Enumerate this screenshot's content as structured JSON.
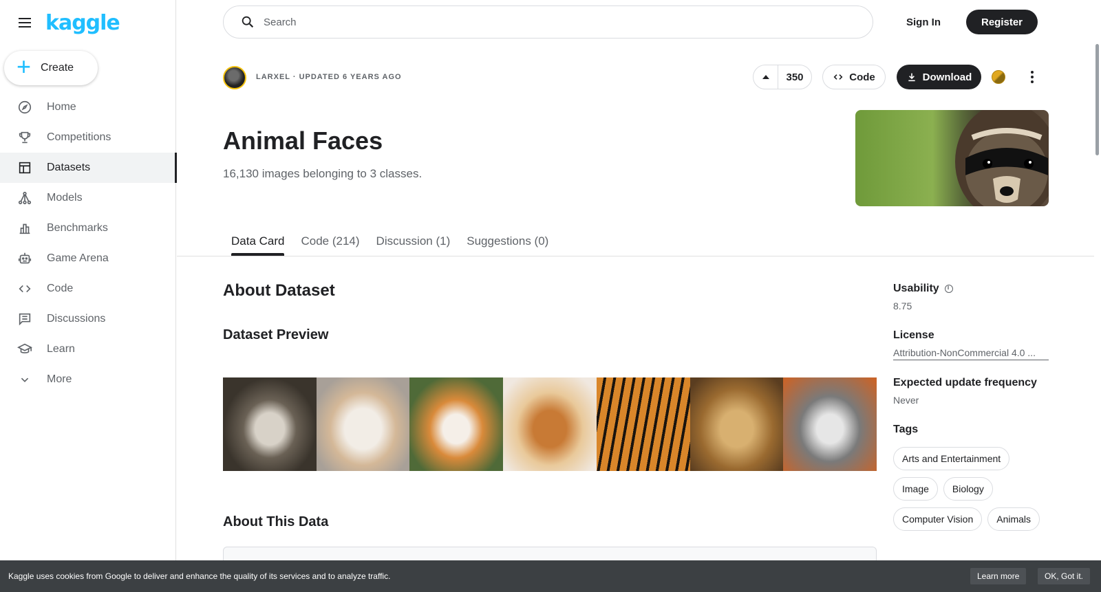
{
  "sidebar": {
    "logo": "kaggle",
    "create_label": "Create",
    "items": [
      {
        "label": "Home",
        "icon": "compass-icon"
      },
      {
        "label": "Competitions",
        "icon": "trophy-icon"
      },
      {
        "label": "Datasets",
        "icon": "table-icon",
        "active": true
      },
      {
        "label": "Models",
        "icon": "models-icon"
      },
      {
        "label": "Benchmarks",
        "icon": "bar-chart-icon"
      },
      {
        "label": "Game Arena",
        "icon": "robot-icon"
      },
      {
        "label": "Code",
        "icon": "code-icon"
      },
      {
        "label": "Discussions",
        "icon": "comment-icon"
      },
      {
        "label": "Learn",
        "icon": "school-icon"
      },
      {
        "label": "More",
        "icon": "chevron-down-icon"
      }
    ]
  },
  "header": {
    "search_placeholder": "Search",
    "sign_in": "Sign In",
    "register": "Register"
  },
  "dataset": {
    "owner_line": "LARXEL · UPDATED 6 YEARS AGO",
    "votes": "350",
    "code_label": "Code",
    "download_label": "Download",
    "title": "Animal Faces",
    "subtitle": "16,130 images belonging to 3 classes."
  },
  "tabs": [
    "Data Card",
    "Code (214)",
    "Discussion (1)",
    "Suggestions (0)"
  ],
  "content": {
    "about_heading": "About Dataset",
    "preview_heading": "Dataset Preview",
    "about_data_heading": "About This Data"
  },
  "meta": {
    "usability_label": "Usability",
    "usability_value": "8.75",
    "license_label": "License",
    "license_value": "Attribution-NonCommercial 4.0 ...",
    "frequency_label": "Expected update frequency",
    "frequency_value": "Never",
    "tags_label": "Tags",
    "tags": [
      "Arts and Entertainment",
      "Image",
      "Biology",
      "Computer Vision",
      "Animals"
    ]
  },
  "cookie": {
    "message": "Kaggle uses cookies from Google to deliver and enhance the quality of its services and to analyze traffic.",
    "learn_more": "Learn more",
    "ok": "OK, Got it."
  },
  "colors": {
    "brand": "#20beff",
    "primary_dark": "#202124",
    "cookie_bg": "#3c4043"
  }
}
